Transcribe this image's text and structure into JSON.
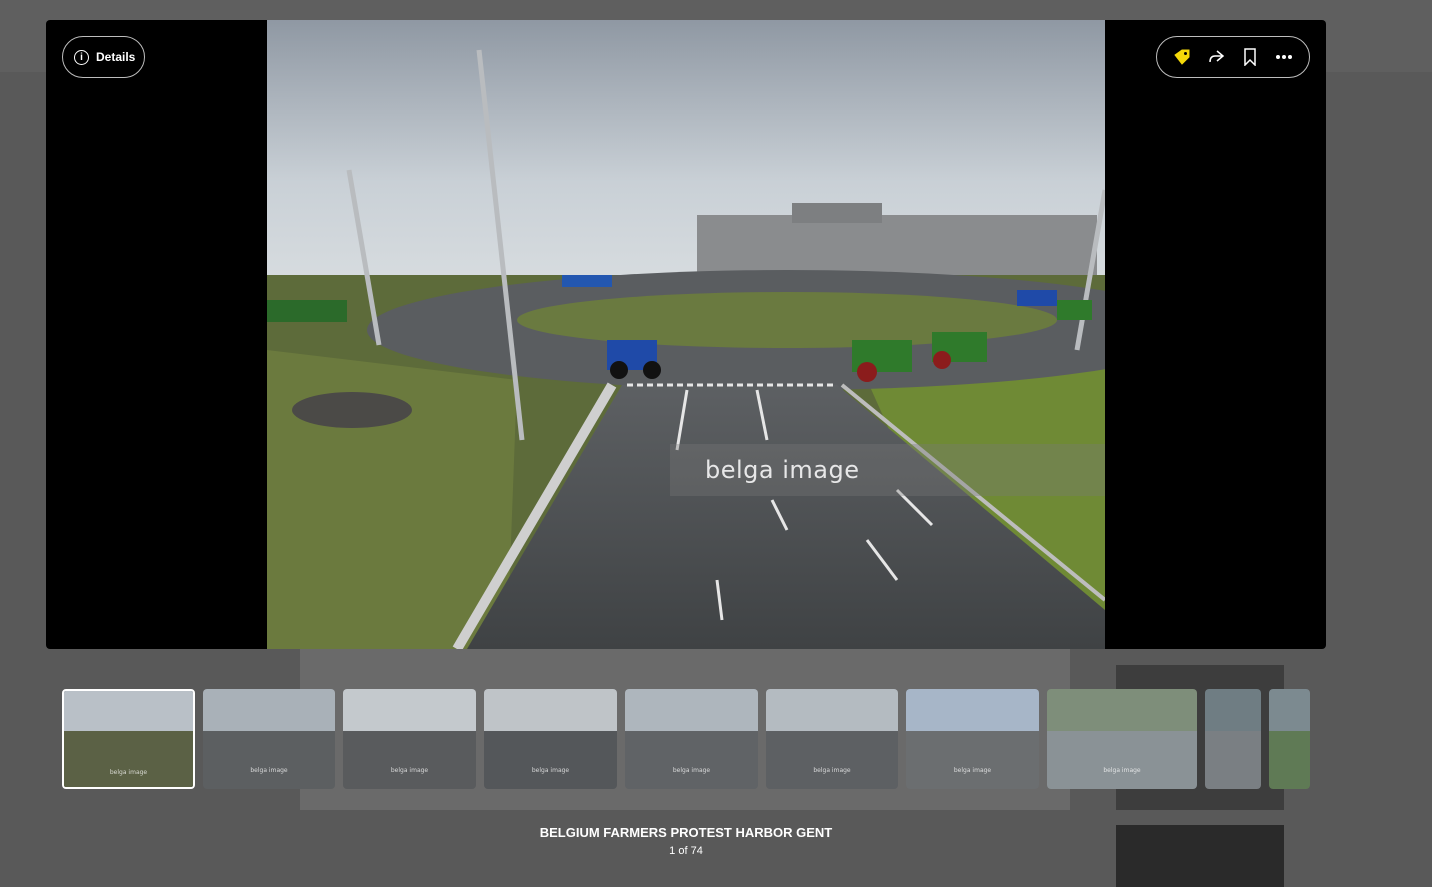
{
  "viewer": {
    "details_label": "Details",
    "watermark": "belga image",
    "actions": [
      "price-tag-icon",
      "share-icon",
      "bookmark-icon",
      "more-icon"
    ],
    "accent_color": "#f5d90a"
  },
  "filmstrip": {
    "thumbnails": [
      {
        "watermark": "belga image",
        "active": true
      },
      {
        "watermark": "belga image"
      },
      {
        "watermark": "belga image"
      },
      {
        "watermark": "belga image"
      },
      {
        "watermark": "belga image"
      },
      {
        "watermark": "belga image"
      },
      {
        "watermark": "belga image"
      },
      {
        "watermark": "belga image"
      },
      {
        "watermark": ""
      },
      {
        "watermark": ""
      }
    ]
  },
  "caption": {
    "title": "BELGIUM FARMERS PROTEST HARBOR GENT",
    "counter": "1 of 74"
  }
}
